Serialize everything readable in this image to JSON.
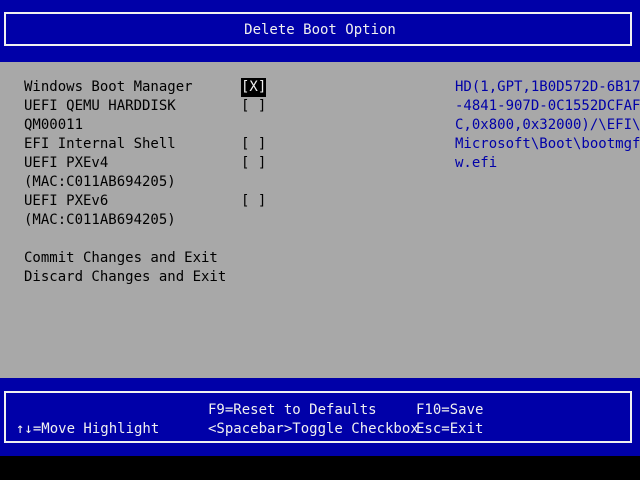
{
  "header": {
    "title": "Delete Boot Option"
  },
  "options": [
    {
      "name_lines": [
        "Windows Boot Manager"
      ],
      "checkbox": "[X]",
      "selected": true
    },
    {
      "name_lines": [
        "UEFI QEMU HARDDISK",
        "QM00011"
      ],
      "checkbox": "[ ]",
      "selected": false
    },
    {
      "name_lines": [
        "EFI Internal Shell"
      ],
      "checkbox": "[ ]",
      "selected": false
    },
    {
      "name_lines": [
        "UEFI PXEv4",
        "(MAC:C011AB694205)"
      ],
      "checkbox": "[ ]",
      "selected": false
    },
    {
      "name_lines": [
        "UEFI PXEv6",
        "(MAC:C011AB694205)"
      ],
      "checkbox": "[ ]",
      "selected": false
    }
  ],
  "actions": [
    "Commit Changes and Exit",
    "Discard Changes and Exit"
  ],
  "help_text": [
    "HD(1,GPT,1B0D572D-6B17",
    "-4841-907D-0C1552DCFAF",
    "C,0x800,0x32000)/\\EFI\\",
    "Microsoft\\Boot\\bootmgf",
    "w.efi"
  ],
  "footer": {
    "move_highlight": "↑↓=Move Highlight",
    "reset_defaults": "F9=Reset to Defaults",
    "toggle_checkbox": "<Spacebar>Toggle Checkbox",
    "save": "F10=Save",
    "exit": "Esc=Exit"
  },
  "colors": {
    "blue": "#0000a8",
    "gray": "#a8a8a8",
    "white": "#f0f0f0",
    "black": "#000000"
  }
}
